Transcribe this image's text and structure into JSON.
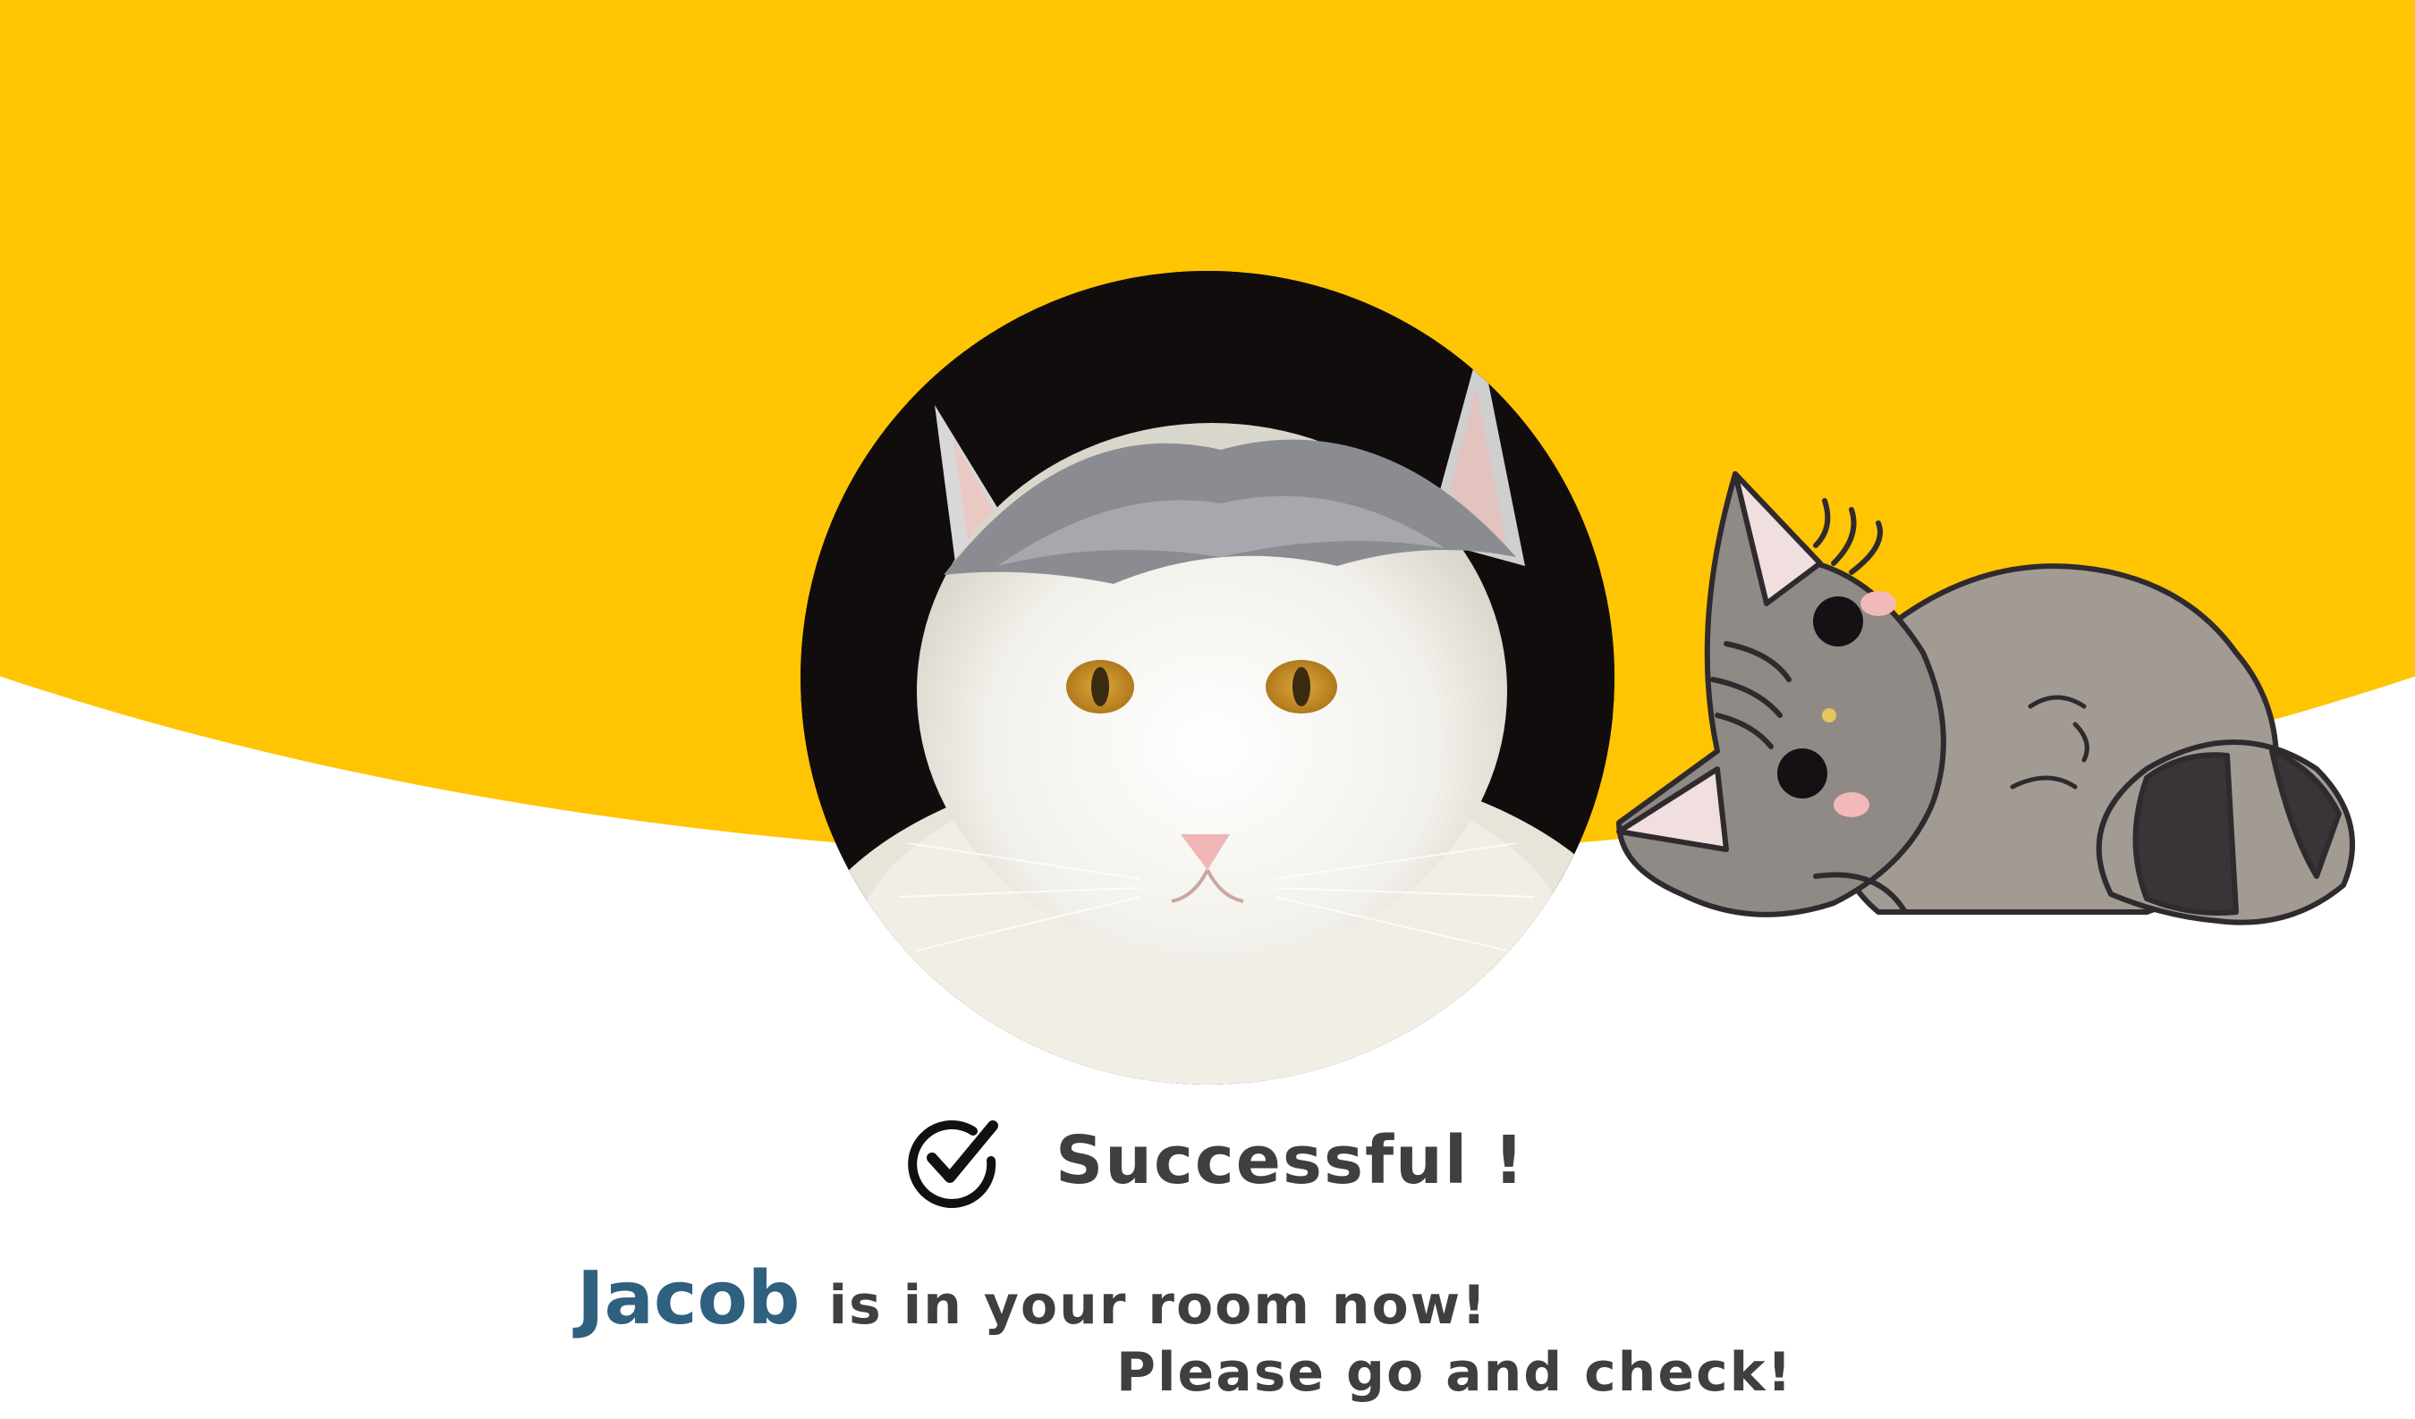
{
  "background": {
    "accent_color": "#FFC503",
    "page_color": "#FFFFFF"
  },
  "photo": {
    "subject": "white-and-grey-long-haired-cat-photo"
  },
  "illustration": {
    "subject": "sleeping-grey-cartoon-cat"
  },
  "status": {
    "icon": "check-circle-icon",
    "text": "Successful !"
  },
  "message": {
    "cat_name": "Jacob",
    "line1_rest": "is in your room now!",
    "line2": "Please go and check!",
    "name_color": "#30607F",
    "text_color": "#3F3F3F"
  }
}
